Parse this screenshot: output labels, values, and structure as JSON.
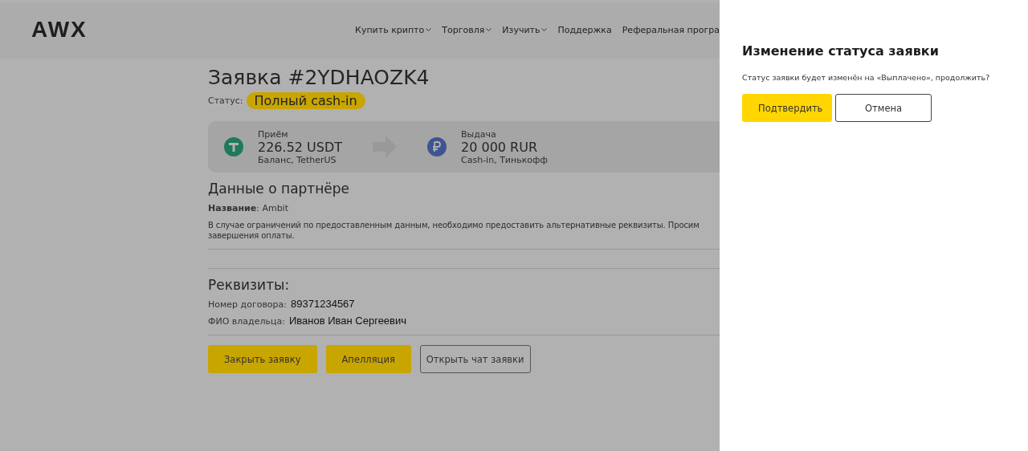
{
  "header": {
    "logo": "AWX",
    "nav": [
      {
        "label": "Купить крипто",
        "dropdown": true
      },
      {
        "label": "Торговля",
        "dropdown": true
      },
      {
        "label": "Изучить",
        "dropdown": true
      },
      {
        "label": "Поддержка",
        "dropdown": false
      },
      {
        "label": "Реферальная програ",
        "dropdown": false
      }
    ]
  },
  "order": {
    "title": "Заявка #2YDHAOZK4",
    "status_label": "Статус:",
    "status": "Полный cash-in"
  },
  "exchange": {
    "from": {
      "caption": "Приём",
      "amount": "226.52 USDT",
      "detail": "Баланс, TetherUS",
      "kind": "tether"
    },
    "to": {
      "caption": "Выдача",
      "amount": "20 000 RUR",
      "detail": "Cash-in, Тинькофф",
      "kind": "ruble"
    }
  },
  "partner": {
    "heading": "Данные о партнёре",
    "name": "**Название**: Ambit",
    "note": "В случае ограничений по предоставленным данным, необходимо предоставить альтернативные реквизиты. Просим\nзавершения оплаты."
  },
  "requisites": {
    "heading": "Реквизиты:",
    "fields": [
      {
        "label": "Номер договора:",
        "value": "89371234567"
      },
      {
        "label": "ФИО владельца:",
        "value": "Иванов Иван Сергеевич"
      }
    ]
  },
  "actions": [
    {
      "label": "Закрыть заявку",
      "kind": "primary"
    },
    {
      "label": "Апелляция",
      "kind": "primary"
    },
    {
      "label": "Открыть чат заявки",
      "kind": "outline"
    }
  ],
  "dialog": {
    "title": "Изменение статуса заявки",
    "message": "Статус заявки будет изменён на «Выплачено», продолжить?",
    "buttons": [
      {
        "label": "Подтвердить",
        "kind": "primary"
      },
      {
        "label": "Отмена",
        "kind": "outline"
      }
    ]
  }
}
